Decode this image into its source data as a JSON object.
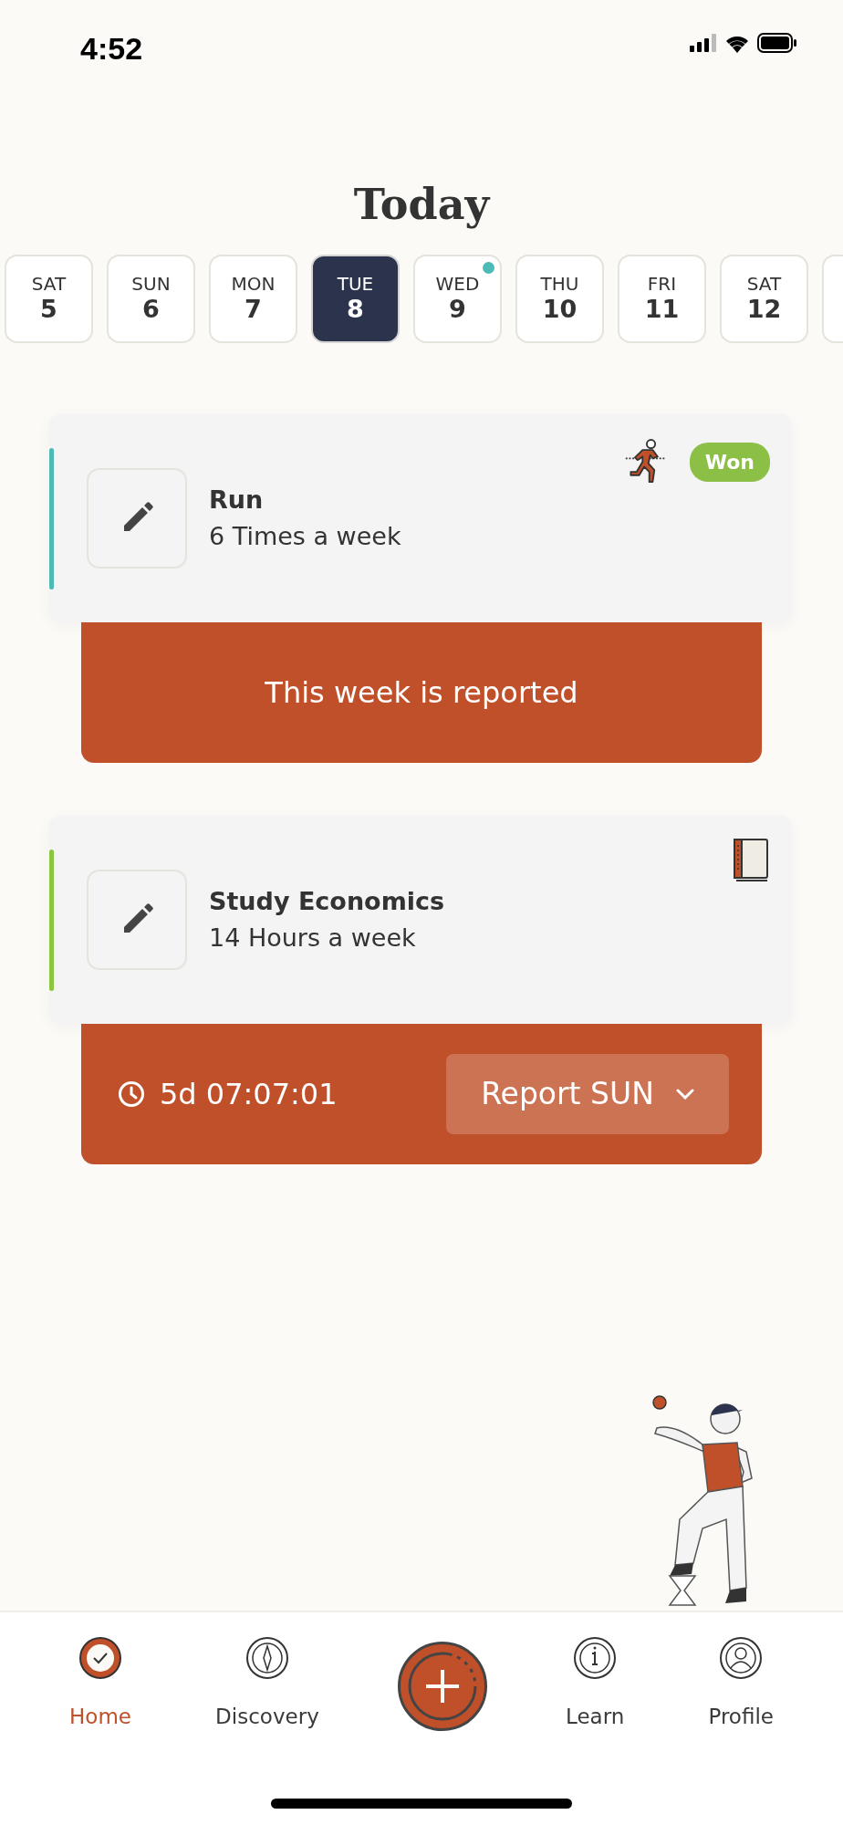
{
  "status_bar": {
    "time": "4:52"
  },
  "title": "Today",
  "days": [
    {
      "weekday": "SAT",
      "day": "5",
      "selected": false,
      "has_event": false
    },
    {
      "weekday": "SUN",
      "day": "6",
      "selected": false,
      "has_event": false
    },
    {
      "weekday": "MON",
      "day": "7",
      "selected": false,
      "has_event": false
    },
    {
      "weekday": "TUE",
      "day": "8",
      "selected": true,
      "has_event": false
    },
    {
      "weekday": "WED",
      "day": "9",
      "selected": false,
      "has_event": true
    },
    {
      "weekday": "THU",
      "day": "10",
      "selected": false,
      "has_event": false
    },
    {
      "weekday": "FRI",
      "day": "11",
      "selected": false,
      "has_event": false
    },
    {
      "weekday": "SAT",
      "day": "12",
      "selected": false,
      "has_event": false
    }
  ],
  "habits": [
    {
      "name": "Run",
      "frequency": "6 Times a week",
      "color": "#4dbab6",
      "kind": "run",
      "badge": "Won",
      "footer": {
        "kind": "message",
        "text": "This week is reported"
      }
    },
    {
      "name": "Study Economics",
      "frequency": "14 Hours a week",
      "color": "#8cc63f",
      "kind": "study",
      "footer": {
        "kind": "timer",
        "time": "5d 07:07:01",
        "button": "Report SUN"
      }
    }
  ],
  "nav": [
    {
      "kind": "home",
      "label": "Home",
      "selected": true
    },
    {
      "kind": "discovery",
      "label": "Discovery",
      "selected": false
    },
    {
      "kind": "add",
      "selected": false
    },
    {
      "kind": "learn",
      "label": "Learn",
      "selected": false
    },
    {
      "kind": "profile",
      "label": "Profile",
      "selected": false
    }
  ]
}
